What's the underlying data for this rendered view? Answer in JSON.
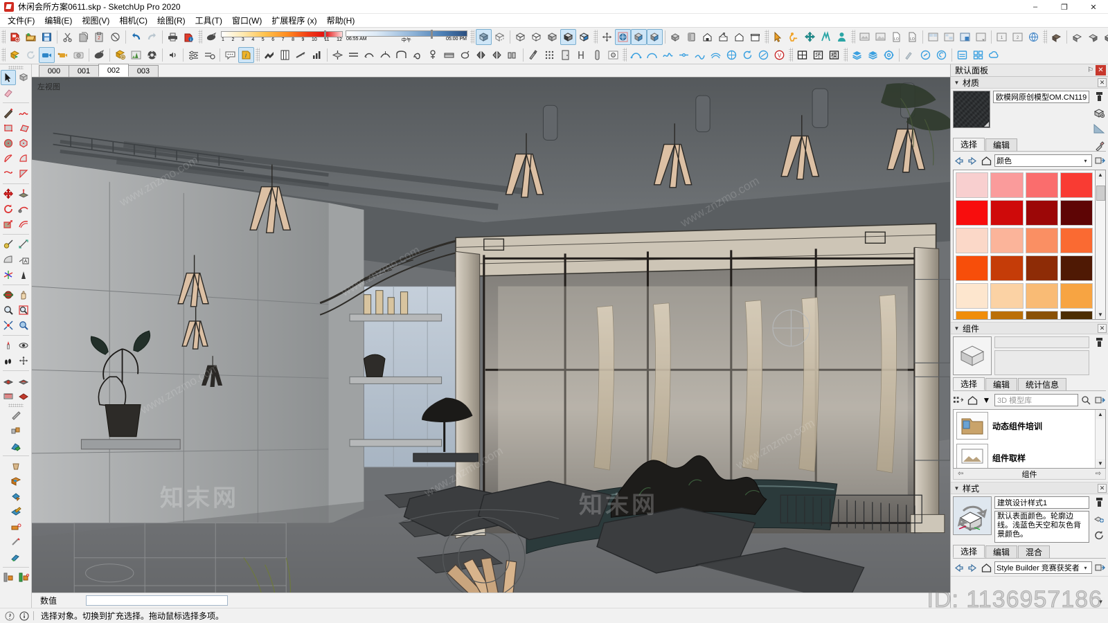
{
  "window": {
    "title": "休闲会所方案0611.skp - SketchUp Pro 2020",
    "minimize": "–",
    "maximize": "❐",
    "close": "✕"
  },
  "menubar": [
    {
      "label": "文件(F)"
    },
    {
      "label": "编辑(E)"
    },
    {
      "label": "视图(V)"
    },
    {
      "label": "相机(C)"
    },
    {
      "label": "绘图(R)"
    },
    {
      "label": "工具(T)"
    },
    {
      "label": "窗口(W)"
    },
    {
      "label": "扩展程序 (x)"
    },
    {
      "label": "帮助(H)"
    }
  ],
  "shadow_toolbar": {
    "months": [
      "1",
      "2",
      "3",
      "4",
      "5",
      "6",
      "7",
      "8",
      "9",
      "10",
      "11",
      "12"
    ],
    "time_start": "06:55 AM",
    "time_noon": "中午",
    "time_end": "05:00 PM"
  },
  "scene_tabs": [
    {
      "label": "000",
      "active": false
    },
    {
      "label": "001",
      "active": false
    },
    {
      "label": "002",
      "active": true
    },
    {
      "label": "003",
      "active": false
    }
  ],
  "viewport": {
    "view_label": "左视图",
    "watermarks": [
      "www.znzmo.com",
      "www.znzmo.com",
      "www.znzmo.com",
      "www.znzmo.com",
      "www.znzmo.com",
      "www.znzmo.com"
    ],
    "big_watermark": "知末网"
  },
  "measurement": {
    "label": "数值",
    "value": ""
  },
  "statusbar": {
    "text": "选择对象。切换到扩充选择。拖动鼠标选择多项。"
  },
  "id_watermark": "ID: 1136957186",
  "tray": {
    "title": "默认面板",
    "pin": "⚐",
    "close": "✕"
  },
  "materials_panel": {
    "title": "材质",
    "collapse": "▼",
    "close": "✕",
    "material_name": "欧模网原创模型OM.CN119",
    "swatch_color": "#2e3133",
    "tabs": [
      {
        "label": "选择",
        "active": true
      },
      {
        "label": "编辑",
        "active": false
      }
    ],
    "library": "颜色",
    "swatches": [
      "#f8cfcf",
      "#fa9b9b",
      "#fa6d6d",
      "#f93b33",
      "#f80d0d",
      "#cf0a0a",
      "#9c0707",
      "#5e0505",
      "#fbd8c8",
      "#fbb49a",
      "#fa8f63",
      "#fa6a32",
      "#f74e0a",
      "#c53c08",
      "#8e2c06",
      "#4f1904",
      "#fde6ce",
      "#fbd2a4",
      "#f9bb75",
      "#f7a442",
      "#f08d0a",
      "#bb6f08",
      "#8a5106",
      "#4c2d03"
    ]
  },
  "components_panel": {
    "title": "组件",
    "collapse": "▼",
    "close": "✕",
    "tabs": [
      {
        "label": "选择",
        "active": true
      },
      {
        "label": "编辑",
        "active": false
      },
      {
        "label": "统计信息",
        "active": false
      }
    ],
    "search_placeholder": "3D 模型库",
    "items": [
      {
        "label": "动态组件培训"
      },
      {
        "label": "组件取样"
      }
    ],
    "pager_label": "组件",
    "pager_prev": "⇦",
    "pager_next": "⇨"
  },
  "styles_panel": {
    "title": "样式",
    "collapse": "▼",
    "close": "✕",
    "style_name": "建筑设计样式1",
    "style_description": "默认表面颜色。轮廓边线。浅蓝色天空和灰色背景颜色。",
    "tabs": [
      {
        "label": "选择",
        "active": true
      },
      {
        "label": "编辑",
        "active": false
      },
      {
        "label": "混合",
        "active": false
      }
    ],
    "library": "Style Builder 竞赛获奖者"
  },
  "toolbar_row1": {
    "groups": [
      {
        "name": "standard",
        "buttons": [
          {
            "name": "new-document-icon",
            "title": "新建"
          },
          {
            "name": "open-document-icon",
            "title": "打开"
          },
          {
            "name": "save-document-icon",
            "title": "保存"
          }
        ]
      },
      {
        "name": "edit",
        "buttons": [
          {
            "name": "cut-icon",
            "title": "剪切"
          },
          {
            "name": "copy-icon",
            "title": "复制"
          },
          {
            "name": "paste-icon",
            "title": "粘贴"
          },
          {
            "name": "erase-icon",
            "title": "删除"
          }
        ]
      },
      {
        "name": "undo",
        "buttons": [
          {
            "name": "undo-icon",
            "title": "撤销"
          },
          {
            "name": "redo-icon",
            "title": "重做"
          }
        ]
      },
      {
        "name": "print",
        "buttons": [
          {
            "name": "print-icon",
            "title": "打印"
          },
          {
            "name": "model-info-icon",
            "title": "模型信息"
          }
        ]
      }
    ]
  }
}
